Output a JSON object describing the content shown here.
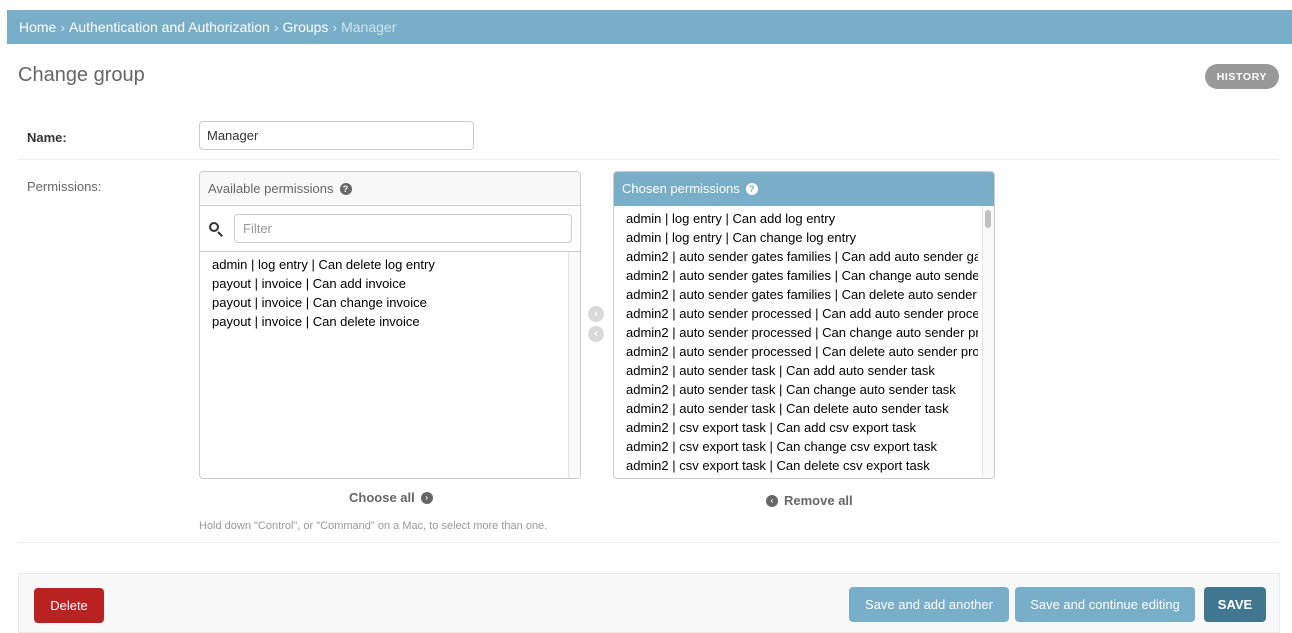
{
  "breadcrumbs": {
    "home": "Home",
    "section": "Authentication and Authorization",
    "model": "Groups",
    "current": "Manager",
    "separator": "›"
  },
  "page": {
    "title": "Change group",
    "history_button": "HISTORY"
  },
  "form": {
    "name_label": "Name:",
    "name_value": "Manager",
    "permissions_label": "Permissions:"
  },
  "available": {
    "title": "Available permissions",
    "help_icon": "?",
    "filter_placeholder": "Filter",
    "items": [
      "admin | log entry | Can delete log entry",
      "payout | invoice | Can add invoice",
      "payout | invoice | Can change invoice",
      "payout | invoice | Can delete invoice"
    ],
    "choose_all": "Choose all"
  },
  "chosen": {
    "title": "Chosen permissions",
    "help_icon": "?",
    "items": [
      "admin | log entry | Can add log entry",
      "admin | log entry | Can change log entry",
      "admin2 | auto sender gates families | Can add auto sender ga",
      "admin2 | auto sender gates families | Can change auto sende",
      "admin2 | auto sender gates families | Can delete auto sender",
      "admin2 | auto sender processed | Can add auto sender proces:",
      "admin2 | auto sender processed | Can change auto sender pr",
      "admin2 | auto sender processed | Can delete auto sender proc",
      "admin2 | auto sender task | Can add auto sender task",
      "admin2 | auto sender task | Can change auto sender task",
      "admin2 | auto sender task | Can delete auto sender task",
      "admin2 | csv export task | Can add csv export task",
      "admin2 | csv export task | Can change csv export task",
      "admin2 | csv export task | Can delete csv export task"
    ],
    "remove_all": "Remove all"
  },
  "help_text": "Hold down \"Control\", or \"Command\" on a Mac, to select more than one.",
  "actions": {
    "delete": "Delete",
    "save_add_another": "Save and add another",
    "save_continue": "Save and continue editing",
    "save": "SAVE"
  },
  "colors": {
    "header": "#79aec8",
    "primary": "#417690",
    "danger": "#ba2121"
  }
}
